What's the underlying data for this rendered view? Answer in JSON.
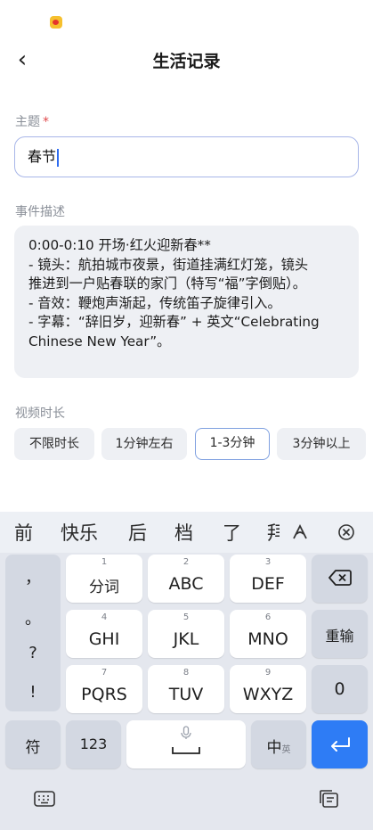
{
  "nav": {
    "back_glyph": "‹",
    "title": "生活记录"
  },
  "form": {
    "topic_label": "主题",
    "topic_required_mark": "*",
    "topic_value": "春节",
    "desc_label": "事件描述",
    "desc_lines": [
      "0:00-0:10 开场·红火迎新春**",
      "- 镜头：航拍城市夜景，街道挂满红灯笼，镜头",
      "推进到一户贴春联的家门（特写“福”字倒贴）。",
      "- 音效：鞭炮声渐起，传统笛子旋律引入。",
      "- 字幕：“辞旧岁，迎新春” + 英文“Celebrating",
      "Chinese New Year”。"
    ],
    "duration_label": "视频时长",
    "duration_options": [
      "不限时长",
      "1分钟左右",
      "1-3分钟",
      "3分钟以上"
    ],
    "duration_selected": "1-3分钟"
  },
  "keyboard": {
    "candidates": [
      "前",
      "快乐",
      "后",
      "档",
      "了",
      "拜"
    ],
    "side_punct": [
      "，",
      "。",
      "?",
      "!"
    ],
    "keys": [
      {
        "num": "1",
        "label": "分词"
      },
      {
        "num": "2",
        "label": "ABC"
      },
      {
        "num": "3",
        "label": "DEF"
      },
      {
        "num": "4",
        "label": "GHI"
      },
      {
        "num": "5",
        "label": "JKL"
      },
      {
        "num": "6",
        "label": "MNO"
      },
      {
        "num": "7",
        "label": "PQRS"
      },
      {
        "num": "8",
        "label": "TUV"
      },
      {
        "num": "9",
        "label": "WXYZ"
      }
    ],
    "reenter_label": "重输",
    "zero_label": "0",
    "symbol_label": "符",
    "num_label": "123",
    "lang_label": "中",
    "lang_sub": "英"
  },
  "icons": {
    "status": "weibo-app-icon",
    "back": "back-chevron-icon",
    "delete": "backspace-icon",
    "mic": "microphone-icon",
    "enter": "enter-icon",
    "handwrite": "handwriting-icon",
    "close": "close-circle-icon",
    "keyboard_switch": "keyboard-icon",
    "clipboard": "clipboard-icon"
  },
  "colors": {
    "accent": "#2e7cf5",
    "required": "#e0494c",
    "input_border": "#a8b6e8"
  }
}
